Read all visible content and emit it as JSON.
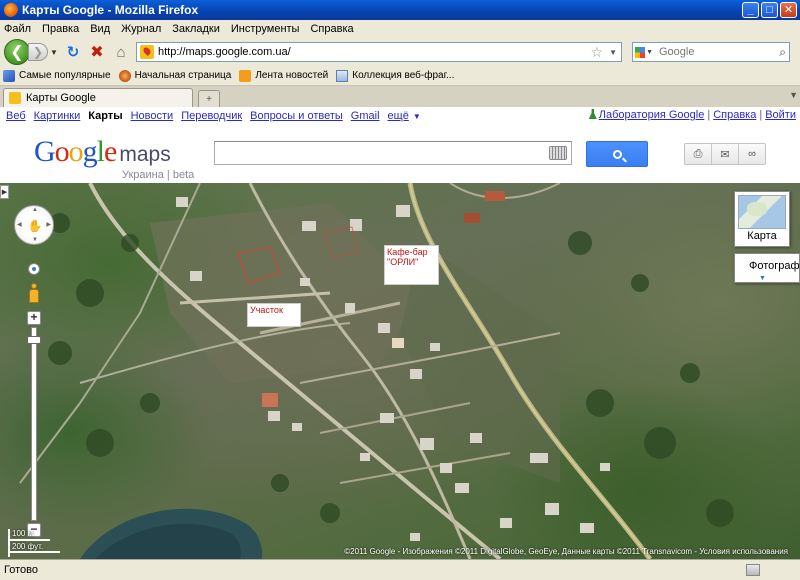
{
  "window": {
    "title": "Карты Google - Mozilla Firefox",
    "buttons": {
      "minimize": "_",
      "maximize": "□",
      "close": "✕"
    }
  },
  "menu": [
    "Файл",
    "Правка",
    "Вид",
    "Журнал",
    "Закладки",
    "Инструменты",
    "Справка"
  ],
  "nav": {
    "url": "http://maps.google.com.ua/",
    "search_placeholder": "Google"
  },
  "bookmarks": [
    {
      "label": "Самые популярные",
      "icon": "popular-icon"
    },
    {
      "label": "Начальная страница",
      "icon": "firefox-icon"
    },
    {
      "label": "Лента новостей",
      "icon": "rss-icon"
    },
    {
      "label": "Коллекция веб-фраг...",
      "icon": "webslice-icon"
    }
  ],
  "tab": {
    "title": "Карты Google",
    "new_tab": "+"
  },
  "gbar": {
    "links": [
      "Веб",
      "Картинки",
      "Карты",
      "Новости",
      "Переводчик",
      "Вопросы и ответы",
      "Gmail",
      "ещё"
    ],
    "selected": "Карты",
    "more_arrow": "▼",
    "right": [
      "Лаборатория Google",
      "Справка",
      "Войти"
    ]
  },
  "logo": {
    "letters": [
      "G",
      "o",
      "o",
      "g",
      "l",
      "e"
    ],
    "product": "maps",
    "subtitle": "Украина | beta"
  },
  "map": {
    "labels": {
      "plot": "Участок",
      "cafe_line1": "Кафе-бар",
      "cafe_line2": "\"ОРЛИ\""
    },
    "map_type_map": "Карта",
    "map_type_satellite": "Фотографии",
    "scale_metric": "100 м",
    "scale_imperial": "200 фут.",
    "copyright": "©2011 Google - Изображения ©2011 DigitalGlobe, GeoEye, Данные карты ©2011 Transnavicom - Условия использования"
  },
  "status": {
    "text": "Готово"
  },
  "colors": {
    "title_bar": "#0842b0",
    "link": "#2a2ac4",
    "search_button": "#4d90fe",
    "label_text": "#c01414"
  }
}
